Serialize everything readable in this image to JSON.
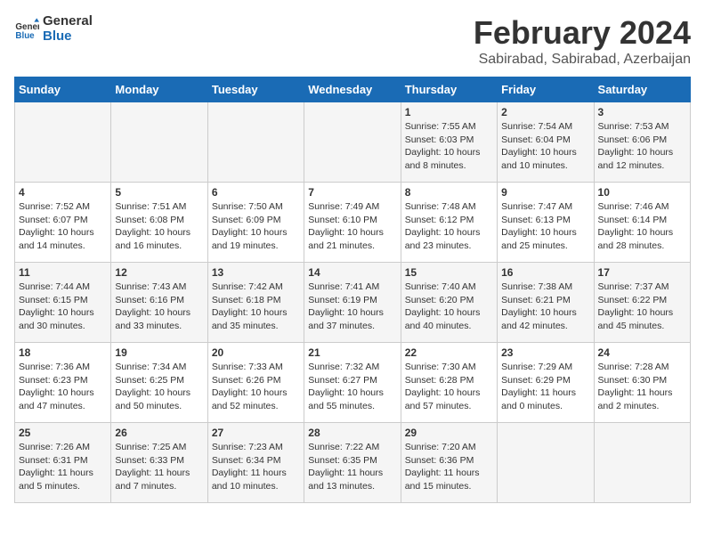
{
  "logo": {
    "text_general": "General",
    "text_blue": "Blue"
  },
  "title": "February 2024",
  "subtitle": "Sabirabad, Sabirabad, Azerbaijan",
  "days_header": [
    "Sunday",
    "Monday",
    "Tuesday",
    "Wednesday",
    "Thursday",
    "Friday",
    "Saturday"
  ],
  "weeks": [
    [
      {
        "day": "",
        "info": ""
      },
      {
        "day": "",
        "info": ""
      },
      {
        "day": "",
        "info": ""
      },
      {
        "day": "",
        "info": ""
      },
      {
        "day": "1",
        "info": "Sunrise: 7:55 AM\nSunset: 6:03 PM\nDaylight: 10 hours and 8 minutes."
      },
      {
        "day": "2",
        "info": "Sunrise: 7:54 AM\nSunset: 6:04 PM\nDaylight: 10 hours and 10 minutes."
      },
      {
        "day": "3",
        "info": "Sunrise: 7:53 AM\nSunset: 6:06 PM\nDaylight: 10 hours and 12 minutes."
      }
    ],
    [
      {
        "day": "4",
        "info": "Sunrise: 7:52 AM\nSunset: 6:07 PM\nDaylight: 10 hours and 14 minutes."
      },
      {
        "day": "5",
        "info": "Sunrise: 7:51 AM\nSunset: 6:08 PM\nDaylight: 10 hours and 16 minutes."
      },
      {
        "day": "6",
        "info": "Sunrise: 7:50 AM\nSunset: 6:09 PM\nDaylight: 10 hours and 19 minutes."
      },
      {
        "day": "7",
        "info": "Sunrise: 7:49 AM\nSunset: 6:10 PM\nDaylight: 10 hours and 21 minutes."
      },
      {
        "day": "8",
        "info": "Sunrise: 7:48 AM\nSunset: 6:12 PM\nDaylight: 10 hours and 23 minutes."
      },
      {
        "day": "9",
        "info": "Sunrise: 7:47 AM\nSunset: 6:13 PM\nDaylight: 10 hours and 25 minutes."
      },
      {
        "day": "10",
        "info": "Sunrise: 7:46 AM\nSunset: 6:14 PM\nDaylight: 10 hours and 28 minutes."
      }
    ],
    [
      {
        "day": "11",
        "info": "Sunrise: 7:44 AM\nSunset: 6:15 PM\nDaylight: 10 hours and 30 minutes."
      },
      {
        "day": "12",
        "info": "Sunrise: 7:43 AM\nSunset: 6:16 PM\nDaylight: 10 hours and 33 minutes."
      },
      {
        "day": "13",
        "info": "Sunrise: 7:42 AM\nSunset: 6:18 PM\nDaylight: 10 hours and 35 minutes."
      },
      {
        "day": "14",
        "info": "Sunrise: 7:41 AM\nSunset: 6:19 PM\nDaylight: 10 hours and 37 minutes."
      },
      {
        "day": "15",
        "info": "Sunrise: 7:40 AM\nSunset: 6:20 PM\nDaylight: 10 hours and 40 minutes."
      },
      {
        "day": "16",
        "info": "Sunrise: 7:38 AM\nSunset: 6:21 PM\nDaylight: 10 hours and 42 minutes."
      },
      {
        "day": "17",
        "info": "Sunrise: 7:37 AM\nSunset: 6:22 PM\nDaylight: 10 hours and 45 minutes."
      }
    ],
    [
      {
        "day": "18",
        "info": "Sunrise: 7:36 AM\nSunset: 6:23 PM\nDaylight: 10 hours and 47 minutes."
      },
      {
        "day": "19",
        "info": "Sunrise: 7:34 AM\nSunset: 6:25 PM\nDaylight: 10 hours and 50 minutes."
      },
      {
        "day": "20",
        "info": "Sunrise: 7:33 AM\nSunset: 6:26 PM\nDaylight: 10 hours and 52 minutes."
      },
      {
        "day": "21",
        "info": "Sunrise: 7:32 AM\nSunset: 6:27 PM\nDaylight: 10 hours and 55 minutes."
      },
      {
        "day": "22",
        "info": "Sunrise: 7:30 AM\nSunset: 6:28 PM\nDaylight: 10 hours and 57 minutes."
      },
      {
        "day": "23",
        "info": "Sunrise: 7:29 AM\nSunset: 6:29 PM\nDaylight: 11 hours and 0 minutes."
      },
      {
        "day": "24",
        "info": "Sunrise: 7:28 AM\nSunset: 6:30 PM\nDaylight: 11 hours and 2 minutes."
      }
    ],
    [
      {
        "day": "25",
        "info": "Sunrise: 7:26 AM\nSunset: 6:31 PM\nDaylight: 11 hours and 5 minutes."
      },
      {
        "day": "26",
        "info": "Sunrise: 7:25 AM\nSunset: 6:33 PM\nDaylight: 11 hours and 7 minutes."
      },
      {
        "day": "27",
        "info": "Sunrise: 7:23 AM\nSunset: 6:34 PM\nDaylight: 11 hours and 10 minutes."
      },
      {
        "day": "28",
        "info": "Sunrise: 7:22 AM\nSunset: 6:35 PM\nDaylight: 11 hours and 13 minutes."
      },
      {
        "day": "29",
        "info": "Sunrise: 7:20 AM\nSunset: 6:36 PM\nDaylight: 11 hours and 15 minutes."
      },
      {
        "day": "",
        "info": ""
      },
      {
        "day": "",
        "info": ""
      }
    ]
  ]
}
